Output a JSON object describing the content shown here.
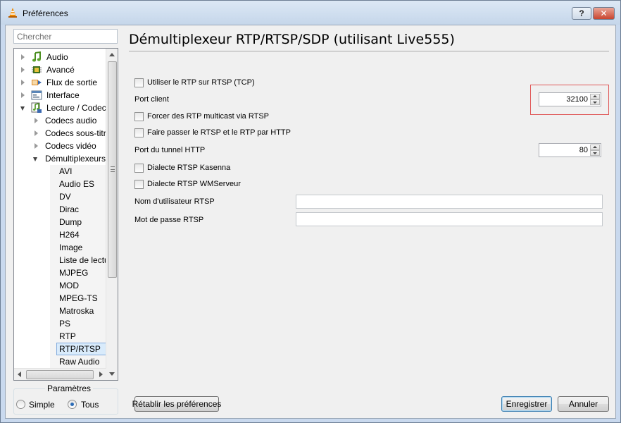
{
  "window": {
    "title": "Préférences",
    "help_label": "?",
    "close_label": "✕"
  },
  "search": {
    "placeholder": "Chercher"
  },
  "tree": {
    "items": [
      {
        "label": "Audio",
        "level": 0,
        "expanded": false,
        "icon": "music-note-icon"
      },
      {
        "label": "Avancé",
        "level": 0,
        "expanded": false,
        "icon": "chip-icon"
      },
      {
        "label": "Flux de sortie",
        "level": 0,
        "expanded": false,
        "icon": "stream-output-icon"
      },
      {
        "label": "Interface",
        "level": 0,
        "expanded": false,
        "icon": "interface-icon"
      },
      {
        "label": "Lecture / Codecs",
        "level": 0,
        "expanded": true,
        "icon": "codec-icon"
      },
      {
        "label": "Codecs audio",
        "level": 1,
        "expanded": false
      },
      {
        "label": "Codecs sous-titres",
        "level": 1,
        "expanded": false
      },
      {
        "label": "Codecs vidéo",
        "level": 1,
        "expanded": false
      },
      {
        "label": "Démultiplexeurs",
        "level": 1,
        "expanded": true
      },
      {
        "label": "AVI",
        "level": 2
      },
      {
        "label": "Audio ES",
        "level": 2
      },
      {
        "label": "DV",
        "level": 2
      },
      {
        "label": "Dirac",
        "level": 2
      },
      {
        "label": "Dump",
        "level": 2
      },
      {
        "label": "H264",
        "level": 2
      },
      {
        "label": "Image",
        "level": 2
      },
      {
        "label": "Liste de lecture",
        "level": 2
      },
      {
        "label": "MJPEG",
        "level": 2
      },
      {
        "label": "MOD",
        "level": 2
      },
      {
        "label": "MPEG-TS",
        "level": 2
      },
      {
        "label": "Matroska",
        "level": 2
      },
      {
        "label": "PS",
        "level": 2
      },
      {
        "label": "RTP",
        "level": 2
      },
      {
        "label": "RTP/RTSP",
        "level": 2,
        "selected": true
      },
      {
        "label": "Raw Audio",
        "level": 2
      }
    ]
  },
  "params": {
    "title": "Paramètres",
    "simple_label": "Simple",
    "all_label": "Tous",
    "selected": "Tous"
  },
  "panel": {
    "title": "Démultiplexeur RTP/RTSP/SDP (utilisant Live555)",
    "rtp_over_rtsp_label": "Utiliser le RTP sur RTSP (TCP)",
    "client_port_label": "Port client",
    "client_port_value": "32100",
    "force_multicast_label": "Forcer des RTP multicast via RTSP",
    "http_tunnel_label": "Faire passer le RTSP et le RTP par HTTP",
    "http_tunnel_port_label": "Port du tunnel HTTP",
    "http_tunnel_port_value": "80",
    "kasenna_label": "Dialecte RTSP Kasenna",
    "wmserver_label": "Dialecte RTSP WMServeur",
    "username_label": "Nom d'utilisateur RTSP",
    "username_value": "",
    "password_label": "Mot de passe RTSP",
    "password_value": ""
  },
  "footer": {
    "reset_label": "Rétablir les préférences",
    "save_label": "Enregistrer",
    "cancel_label": "Annuler"
  }
}
